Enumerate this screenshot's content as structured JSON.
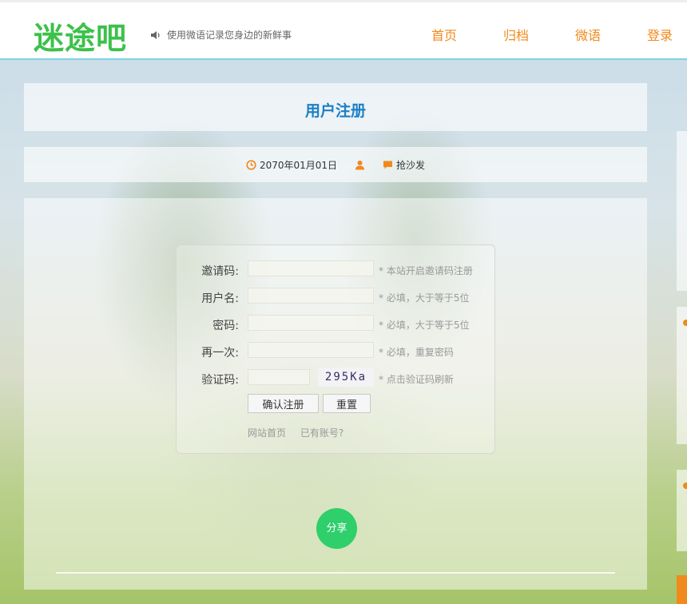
{
  "header": {
    "logo": "迷途吧",
    "slogan": "使用微语记录您身边的新鲜事",
    "nav": [
      "首页",
      "归档",
      "微语",
      "登录"
    ]
  },
  "page": {
    "title": "用户注册",
    "date": "2070年01月01日",
    "comment": "抢沙发"
  },
  "form": {
    "fields": [
      {
        "label": "邀请码:",
        "value": "",
        "hint": "* 本站开启邀请码注册"
      },
      {
        "label": "用户名:",
        "value": "",
        "hint": "* 必填，大于等于5位"
      },
      {
        "label": "密码:",
        "value": "",
        "hint": "* 必填，大于等于5位"
      },
      {
        "label": "再一次:",
        "value": "",
        "hint": "* 必填，重复密码"
      },
      {
        "label": "验证码:",
        "value": "",
        "hint": "* 点击验证码刷新"
      }
    ],
    "captcha_text": "295Ka",
    "submit_label": "确认注册",
    "reset_label": "重置",
    "link_home": "网站首页",
    "link_account": "已有账号?"
  },
  "share_label": "分享",
  "colors": {
    "logo": "#3cc14a",
    "nav": "#f08a1c",
    "title": "#1d7fc6",
    "share": "#2fcf6b",
    "icon_orange": "#f08a1c"
  },
  "icons": {
    "slogan": "speaker-icon",
    "date": "clock-icon",
    "author": "user-icon",
    "comment": "comment-icon"
  }
}
